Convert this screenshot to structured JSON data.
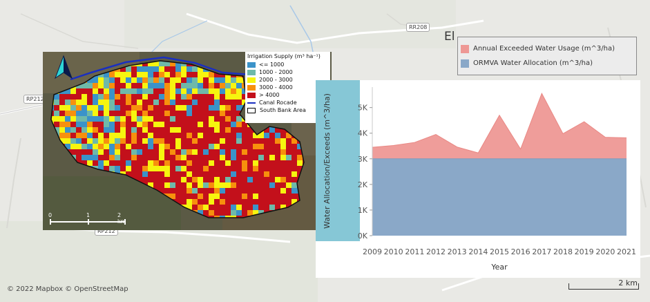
{
  "basemap": {
    "road_labels": [
      "RR208",
      "RP212",
      "RP212"
    ],
    "town_label": "El",
    "attribution": "© 2022 Mapbox © OpenStreetMap",
    "scale_label": "2 km"
  },
  "inset_map": {
    "legend_title": "Irrigation Supply (m³ ha⁻¹)",
    "legend_items": [
      {
        "label": "<= 1000",
        "color": "#3b93c9"
      },
      {
        "label": "1000 - 2000",
        "color": "#6fb9a9"
      },
      {
        "label": "2000 - 3000",
        "color": "#f6f50f"
      },
      {
        "label": "3000 - 4000",
        "color": "#f7900d"
      },
      {
        "label": "> 4000",
        "color": "#c3101b"
      }
    ],
    "canal_label": "Canal Rocade",
    "canal_color": "#1a2fc0",
    "area_label": "South Bank Area",
    "scale_ticks": [
      "0",
      "1",
      "2 km"
    ],
    "north_arrow": "north-arrow-icon"
  },
  "legend": {
    "items": [
      {
        "label": "Annual Exceeded Water Usage (m^3/ha)",
        "color": "#ee9895"
      },
      {
        "label": "ORMVA Water Allocation (m^3/ha)",
        "color": "#8aa8c8"
      }
    ]
  },
  "chart_data": {
    "type": "area",
    "x": [
      2009,
      2010,
      2011,
      2012,
      2013,
      2014,
      2015,
      2016,
      2017,
      2018,
      2019,
      2020,
      2021
    ],
    "series": [
      {
        "name": "Annual Exceeded Water Usage (m^3/ha)",
        "values": [
          3450,
          3520,
          3640,
          3950,
          3460,
          3230,
          4700,
          3380,
          5550,
          3980,
          4450,
          3840,
          3820
        ],
        "color": "#ee9895"
      },
      {
        "name": "ORMVA Water Allocation (m^3/ha)",
        "values": [
          3000,
          3000,
          3000,
          3000,
          3000,
          3000,
          3000,
          3000,
          3000,
          3000,
          3000,
          3000,
          3000
        ],
        "color": "#8aa8c8"
      }
    ],
    "yticks": [
      "0K",
      "1K",
      "2K",
      "3K",
      "4K",
      "5K"
    ],
    "ylim": [
      0,
      5800
    ],
    "xlabel": "Year",
    "ylabel": "Water Allocation/Exceeds (m^3/ha)",
    "grid": false
  }
}
